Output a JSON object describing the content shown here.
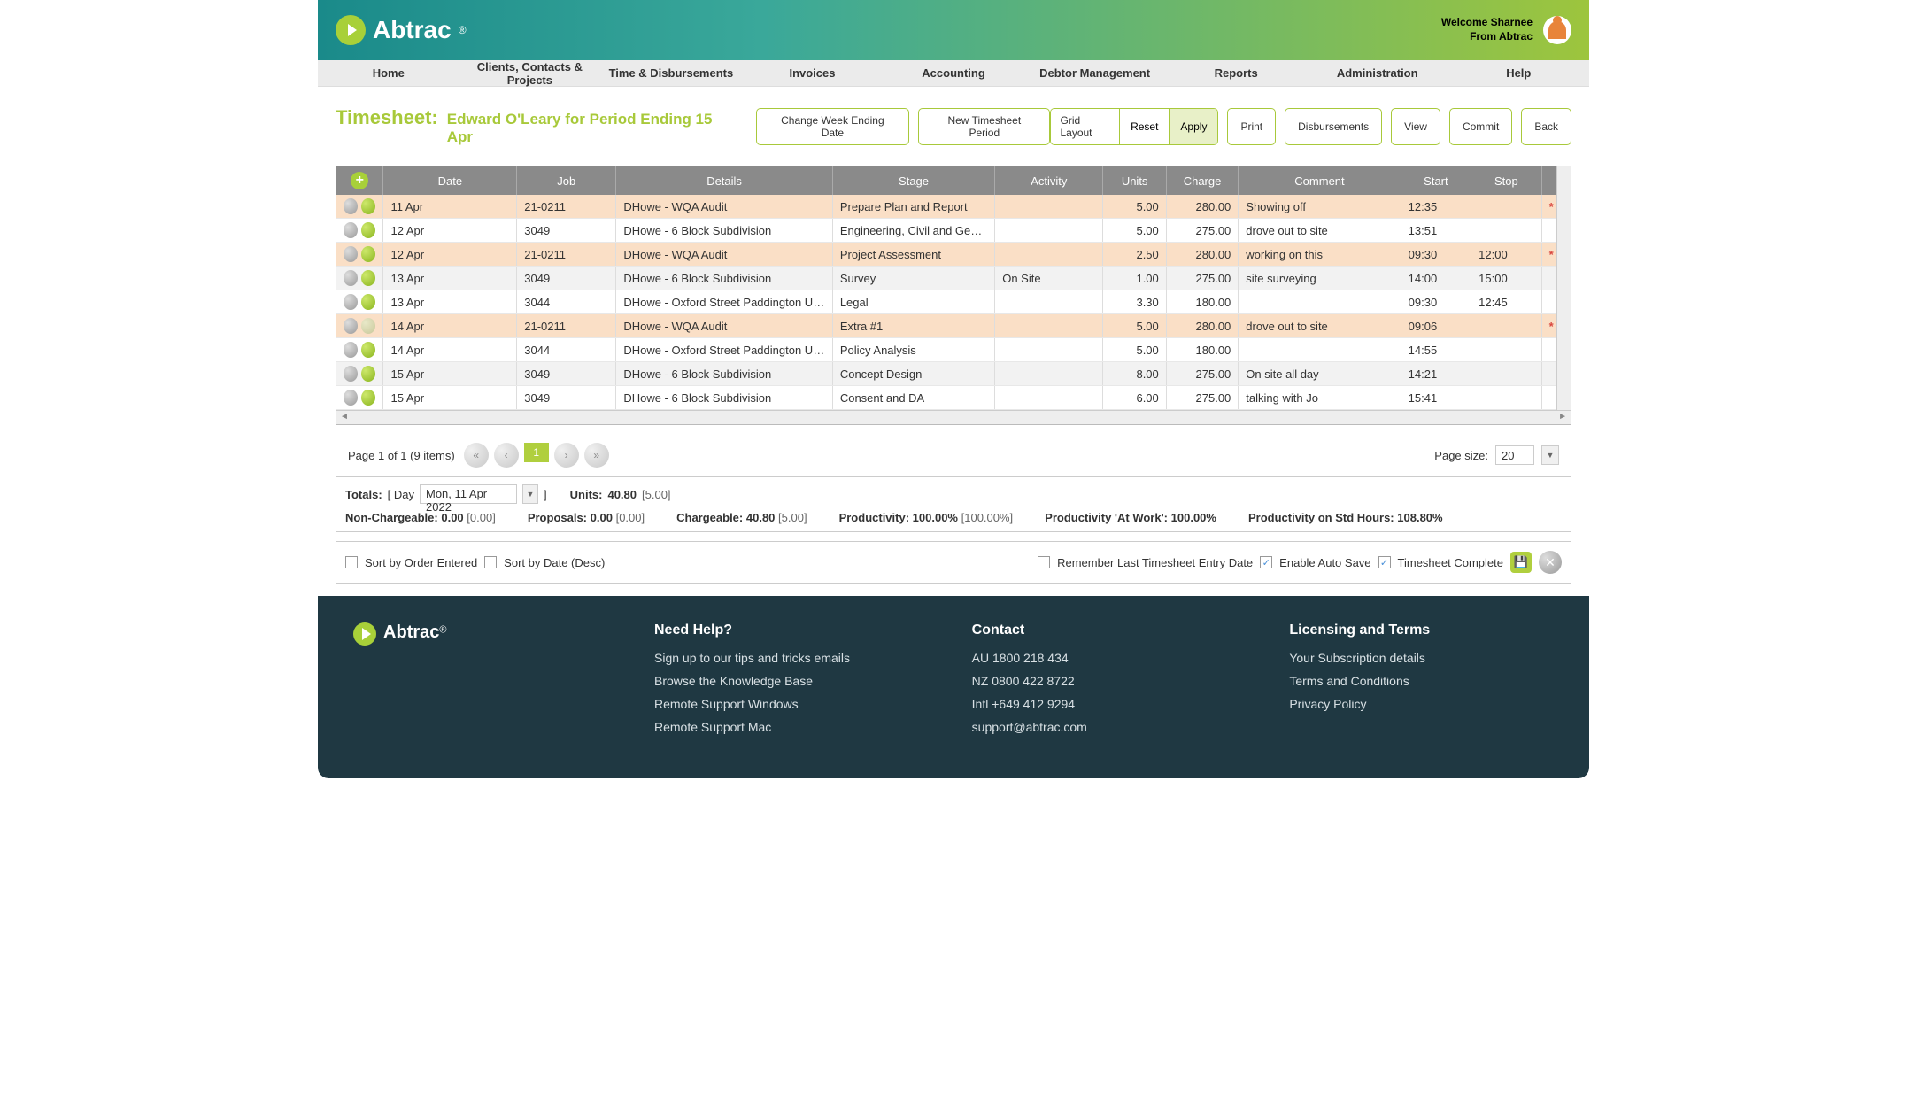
{
  "header": {
    "brand": "Abtrac",
    "reg": "®",
    "welcome_line1": "Welcome Sharnee",
    "welcome_line2": "From Abtrac"
  },
  "nav": [
    "Home",
    "Clients, Contacts & Projects",
    "Time & Disbursements",
    "Invoices",
    "Accounting",
    "Debtor Management",
    "Reports",
    "Administration",
    "Help"
  ],
  "title": {
    "main": "Timesheet:",
    "sub": "Edward O'Leary for Period Ending 15 Apr"
  },
  "actions": {
    "change_week": "Change Week Ending Date",
    "new_period": "New Timesheet Period",
    "grid_label": "Grid Layout",
    "reset": "Reset",
    "apply": "Apply",
    "print": "Print",
    "disbursements": "Disbursements",
    "view": "View",
    "commit": "Commit",
    "back": "Back"
  },
  "table": {
    "columns": [
      "Date",
      "Job",
      "Details",
      "Stage",
      "Activity",
      "Units",
      "Charge",
      "Comment",
      "Start",
      "Stop"
    ],
    "rows": [
      {
        "hl": true,
        "iconDim": false,
        "date": "11 Apr",
        "job": "21-0211",
        "details": "DHowe - WQA Audit",
        "stage": "Prepare Plan and Report",
        "activity": "",
        "units": "5.00",
        "charge": "280.00",
        "comment": "Showing off",
        "start": "12:35",
        "stop": "",
        "flag": "*"
      },
      {
        "hl": false,
        "iconDim": false,
        "date": "12 Apr",
        "job": "3049",
        "details": "DHowe - 6 Block Subdivision",
        "stage": "Engineering, Civil and Geotech",
        "activity": "",
        "units": "5.00",
        "charge": "275.00",
        "comment": "drove out to site",
        "start": "13:51",
        "stop": "",
        "flag": ""
      },
      {
        "hl": true,
        "iconDim": false,
        "date": "12 Apr",
        "job": "21-0211",
        "details": "DHowe - WQA Audit",
        "stage": "Project Assessment",
        "activity": "",
        "units": "2.50",
        "charge": "280.00",
        "comment": "working on this",
        "start": "09:30",
        "stop": "12:00",
        "flag": "*"
      },
      {
        "hl": false,
        "alt": true,
        "iconDim": false,
        "date": "13 Apr",
        "job": "3049",
        "details": "DHowe - 6 Block Subdivision",
        "stage": "Survey",
        "activity": "On Site",
        "units": "1.00",
        "charge": "275.00",
        "comment": "site surveying",
        "start": "14:00",
        "stop": "15:00",
        "flag": ""
      },
      {
        "hl": false,
        "iconDim": false,
        "date": "13 Apr",
        "job": "3044",
        "details": "DHowe - Oxford Street Paddington Urban ...",
        "stage": "Legal",
        "activity": "",
        "units": "3.30",
        "charge": "180.00",
        "comment": "",
        "start": "09:30",
        "stop": "12:45",
        "flag": ""
      },
      {
        "hl": true,
        "iconDim": true,
        "date": "14 Apr",
        "job": "21-0211",
        "details": "DHowe - WQA Audit",
        "stage": "Extra #1",
        "activity": "",
        "units": "5.00",
        "charge": "280.00",
        "comment": "drove out to site",
        "start": "09:06",
        "stop": "",
        "flag": "*"
      },
      {
        "hl": false,
        "iconDim": false,
        "date": "14 Apr",
        "job": "3044",
        "details": "DHowe - Oxford Street Paddington Urban ...",
        "stage": "Policy Analysis",
        "activity": "",
        "units": "5.00",
        "charge": "180.00",
        "comment": "",
        "start": "14:55",
        "stop": "",
        "flag": ""
      },
      {
        "hl": false,
        "alt": true,
        "iconDim": false,
        "date": "15 Apr",
        "job": "3049",
        "details": "DHowe - 6 Block Subdivision",
        "stage": "Concept Design",
        "activity": "",
        "units": "8.00",
        "charge": "275.00",
        "comment": "On site all day",
        "start": "14:21",
        "stop": "",
        "flag": ""
      },
      {
        "hl": false,
        "iconDim": false,
        "date": "15 Apr",
        "job": "3049",
        "details": "DHowe - 6 Block Subdivision",
        "stage": "Consent and DA",
        "activity": "",
        "units": "6.00",
        "charge": "275.00",
        "comment": "talking with Jo",
        "start": "15:41",
        "stop": "",
        "flag": ""
      }
    ]
  },
  "pagination": {
    "info": "Page 1 of 1 (9 items)",
    "current": "1",
    "page_size_label": "Page size:",
    "page_size": "20"
  },
  "totals": {
    "label": "Totals:",
    "day_label": "[ Day",
    "day_value": "Mon, 11 Apr 2022",
    "bracket_close": "]",
    "units_label": "Units:",
    "units_val": "40.80",
    "units_sub": "[5.00]",
    "non_chg_label": "Non-Chargeable:",
    "non_chg_val": "0.00",
    "non_chg_sub": "[0.00]",
    "prop_label": "Proposals:",
    "prop_val": "0.00",
    "prop_sub": "[0.00]",
    "chg_label": "Chargeable:",
    "chg_val": "40.80",
    "chg_sub": "[5.00]",
    "prod_label": "Productivity:",
    "prod_val": "100.00%",
    "prod_sub": "[100.00%]",
    "prod_work_label": "Productivity 'At Work':",
    "prod_work_val": "100.00%",
    "prod_std_label": "Productivity on Std Hours:",
    "prod_std_val": "108.80%"
  },
  "options": {
    "sort_order": "Sort by Order Entered",
    "sort_date": "Sort by Date (Desc)",
    "remember": "Remember Last Timesheet Entry Date",
    "autosave": "Enable Auto Save",
    "complete": "Timesheet Complete"
  },
  "footer": {
    "help": {
      "title": "Need Help?",
      "links": [
        "Sign up to our tips and tricks emails",
        "Browse the Knowledge Base",
        "Remote Support Windows",
        "Remote Support Mac"
      ]
    },
    "contact": {
      "title": "Contact",
      "lines": [
        "AU 1800 218 434",
        "NZ 0800 422 8722",
        "Intl +649 412 9294",
        "support@abtrac.com"
      ]
    },
    "licensing": {
      "title": "Licensing and Terms",
      "links": [
        "Your Subscription details",
        "Terms and Conditions",
        "Privacy Policy"
      ]
    }
  }
}
